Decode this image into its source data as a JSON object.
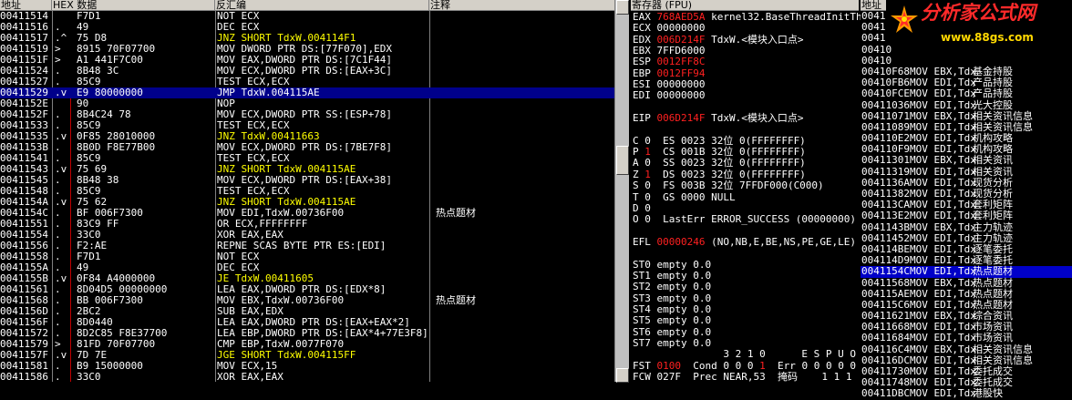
{
  "disasm": {
    "headers": [
      "地址",
      "HEX 数据",
      "反汇编",
      "注释"
    ],
    "rows": [
      {
        "addr": "00411514",
        "mark": "",
        "hex": "F7D1",
        "asm": "NOT ECX",
        "comment": "",
        "jump": false,
        "sel": false
      },
      {
        "addr": "00411516",
        "mark": ".",
        "hex": "49",
        "asm": "DEC ECX",
        "comment": "",
        "jump": false,
        "sel": false
      },
      {
        "addr": "00411517",
        "mark": ".^",
        "hex": "75 D8",
        "asm": "JNZ SHORT TdxW.004114F1",
        "comment": "",
        "jump": true,
        "sel": false
      },
      {
        "addr": "00411519",
        "mark": ">",
        "hex": "8915 70F07700",
        "asm": "MOV DWORD PTR DS:[77F070],EDX",
        "comment": "",
        "jump": false,
        "sel": false
      },
      {
        "addr": "0041151F",
        "mark": ">",
        "hex": "A1 441F7C00",
        "asm": "MOV EAX,DWORD PTR DS:[7C1F44]",
        "comment": "",
        "jump": false,
        "sel": false
      },
      {
        "addr": "00411524",
        "mark": ".",
        "hex": "8B48 3C",
        "asm": "MOV ECX,DWORD PTR DS:[EAX+3C]",
        "comment": "",
        "jump": false,
        "sel": false
      },
      {
        "addr": "00411527",
        "mark": ".",
        "hex": "85C9",
        "asm": "TEST ECX,ECX",
        "comment": "",
        "jump": false,
        "sel": false
      },
      {
        "addr": "00411529",
        "mark": ".v",
        "hex": "E9 80000000",
        "asm": "JMP TdxW.004115AE",
        "comment": "",
        "jump": true,
        "sel": true
      },
      {
        "addr": "0041152E",
        "mark": "",
        "hex": "90",
        "asm": "NOP",
        "comment": "",
        "jump": false,
        "sel": false
      },
      {
        "addr": "0041152F",
        "mark": ".",
        "hex": "8B4C24 78",
        "asm": "MOV ECX,DWORD PTR SS:[ESP+78]",
        "comment": "",
        "jump": false,
        "sel": false
      },
      {
        "addr": "00411533",
        "mark": ".",
        "hex": "85C9",
        "asm": "TEST ECX,ECX",
        "comment": "",
        "jump": false,
        "sel": false
      },
      {
        "addr": "00411535",
        "mark": ".v",
        "hex": "0F85 28010000",
        "asm": "JNZ TdxW.00411663",
        "comment": "",
        "jump": true,
        "sel": false
      },
      {
        "addr": "0041153B",
        "mark": ".",
        "hex": "8B0D F8E77B00",
        "asm": "MOV ECX,DWORD PTR DS:[7BE7F8]",
        "comment": "",
        "jump": false,
        "sel": false
      },
      {
        "addr": "00411541",
        "mark": ".",
        "hex": "85C9",
        "asm": "TEST ECX,ECX",
        "comment": "",
        "jump": false,
        "sel": false
      },
      {
        "addr": "00411543",
        "mark": ".v",
        "hex": "75 69",
        "asm": "JNZ SHORT TdxW.004115AE",
        "comment": "",
        "jump": true,
        "sel": false
      },
      {
        "addr": "00411545",
        "mark": ".",
        "hex": "8B48 38",
        "asm": "MOV ECX,DWORD PTR DS:[EAX+38]",
        "comment": "",
        "jump": false,
        "sel": false
      },
      {
        "addr": "00411548",
        "mark": ".",
        "hex": "85C9",
        "asm": "TEST ECX,ECX",
        "comment": "",
        "jump": false,
        "sel": false
      },
      {
        "addr": "0041154A",
        "mark": ".v",
        "hex": "75 62",
        "asm": "JNZ SHORT TdxW.004115AE",
        "comment": "",
        "jump": true,
        "sel": false
      },
      {
        "addr": "0041154C",
        "mark": ".",
        "hex": "BF 006F7300",
        "asm": "MOV EDI,TdxW.00736F00",
        "comment": "热点题材",
        "jump": false,
        "sel": false
      },
      {
        "addr": "00411551",
        "mark": ".",
        "hex": "83C9 FF",
        "asm": "OR ECX,FFFFFFFF",
        "comment": "",
        "jump": false,
        "sel": false
      },
      {
        "addr": "00411554",
        "mark": ".",
        "hex": "33C0",
        "asm": "XOR EAX,EAX",
        "comment": "",
        "jump": false,
        "sel": false
      },
      {
        "addr": "00411556",
        "mark": ".",
        "hex": "F2:AE",
        "asm": "REPNE SCAS BYTE PTR ES:[EDI]",
        "comment": "",
        "jump": false,
        "sel": false
      },
      {
        "addr": "00411558",
        "mark": ".",
        "hex": "F7D1",
        "asm": "NOT ECX",
        "comment": "",
        "jump": false,
        "sel": false
      },
      {
        "addr": "0041155A",
        "mark": ".",
        "hex": "49",
        "asm": "DEC ECX",
        "comment": "",
        "jump": false,
        "sel": false
      },
      {
        "addr": "0041155B",
        "mark": ".v",
        "hex": "0F84 A4000000",
        "asm": "JE TdxW.00411605",
        "comment": "",
        "jump": true,
        "sel": false
      },
      {
        "addr": "00411561",
        "mark": ".",
        "hex": "8D04D5 00000000",
        "asm": "LEA EAX,DWORD PTR DS:[EDX*8]",
        "comment": "",
        "jump": false,
        "sel": false
      },
      {
        "addr": "00411568",
        "mark": ".",
        "hex": "BB 006F7300",
        "asm": "MOV EBX,TdxW.00736F00",
        "comment": "热点题材",
        "jump": false,
        "sel": false
      },
      {
        "addr": "0041156D",
        "mark": ".",
        "hex": "2BC2",
        "asm": "SUB EAX,EDX",
        "comment": "",
        "jump": false,
        "sel": false
      },
      {
        "addr": "0041156F",
        "mark": ".",
        "hex": "8D0440",
        "asm": "LEA EAX,DWORD PTR DS:[EAX+EAX*2]",
        "comment": "",
        "jump": false,
        "sel": false
      },
      {
        "addr": "00411572",
        "mark": ".",
        "hex": "8D2C85 F8E37700",
        "asm": "LEA EBP,DWORD PTR DS:[EAX*4+77E3F8]",
        "comment": "",
        "jump": false,
        "sel": false
      },
      {
        "addr": "00411579",
        "mark": ">",
        "hex": "81FD 70F07700",
        "asm": "CMP EBP,TdxW.0077F070",
        "comment": "",
        "jump": false,
        "sel": false
      },
      {
        "addr": "0041157F",
        "mark": ".v",
        "hex": "7D 7E",
        "asm": "JGE SHORT TdxW.004115FF",
        "comment": "",
        "jump": true,
        "sel": false
      },
      {
        "addr": "00411581",
        "mark": ".",
        "hex": "B9 15000000",
        "asm": "MOV ECX,15",
        "comment": "",
        "jump": false,
        "sel": false
      },
      {
        "addr": "00411586",
        "mark": ".",
        "hex": "33C0",
        "asm": "XOR EAX,EAX",
        "comment": "",
        "jump": false,
        "sel": false
      }
    ]
  },
  "registers": {
    "header": "寄存器 (FPU)",
    "lines": [
      [
        {
          "t": "EAX "
        },
        {
          "t": "768AED5A",
          "red": true
        },
        {
          "t": " kernel32.BaseThreadInitTh"
        }
      ],
      [
        {
          "t": "ECX 00000000"
        }
      ],
      [
        {
          "t": "EDX "
        },
        {
          "t": "006D214F",
          "red": true
        },
        {
          "t": " TdxW.<模块入口点>"
        }
      ],
      [
        {
          "t": "EBX 7FFD6000"
        }
      ],
      [
        {
          "t": "ESP "
        },
        {
          "t": "0012FF8C",
          "red": true
        }
      ],
      [
        {
          "t": "EBP "
        },
        {
          "t": "0012FF94",
          "red": true
        }
      ],
      [
        {
          "t": "ESI 00000000"
        }
      ],
      [
        {
          "t": "EDI 00000000"
        }
      ],
      [
        {
          "t": ""
        }
      ],
      [
        {
          "t": "EIP "
        },
        {
          "t": "006D214F",
          "red": true
        },
        {
          "t": " TdxW.<模块入口点>"
        }
      ],
      [
        {
          "t": ""
        }
      ],
      [
        {
          "t": "C 0  ES 0023 32位 0(FFFFFFFF)"
        }
      ],
      [
        {
          "t": "P "
        },
        {
          "t": "1",
          "red": true
        },
        {
          "t": "  CS 001B 32位 0(FFFFFFFF)"
        }
      ],
      [
        {
          "t": "A 0  SS 0023 32位 0(FFFFFFFF)"
        }
      ],
      [
        {
          "t": "Z "
        },
        {
          "t": "1",
          "red": true
        },
        {
          "t": "  DS 0023 32位 0(FFFFFFFF)"
        }
      ],
      [
        {
          "t": "S 0  FS 003B 32位 7FFDF000(C000)"
        }
      ],
      [
        {
          "t": "T 0  GS 0000 NULL"
        }
      ],
      [
        {
          "t": "D 0"
        }
      ],
      [
        {
          "t": "O 0  LastErr ERROR_SUCCESS (00000000)"
        }
      ],
      [
        {
          "t": ""
        }
      ],
      [
        {
          "t": "EFL "
        },
        {
          "t": "00000246",
          "red": true
        },
        {
          "t": " (NO,NB,E,BE,NS,PE,GE,LE)"
        }
      ],
      [
        {
          "t": ""
        }
      ],
      [
        {
          "t": "ST0 empty 0.0"
        }
      ],
      [
        {
          "t": "ST1 empty 0.0"
        }
      ],
      [
        {
          "t": "ST2 empty 0.0"
        }
      ],
      [
        {
          "t": "ST3 empty 0.0"
        }
      ],
      [
        {
          "t": "ST4 empty 0.0"
        }
      ],
      [
        {
          "t": "ST5 empty 0.0"
        }
      ],
      [
        {
          "t": "ST6 empty 0.0"
        }
      ],
      [
        {
          "t": "ST7 empty 0.0"
        }
      ],
      [
        {
          "t": "               3 2 1 0      E S P U O"
        }
      ],
      [
        {
          "t": "FST "
        },
        {
          "t": "0100",
          "red": true
        },
        {
          "t": "  Cond 0 0 0 "
        },
        {
          "t": "1",
          "red": true
        },
        {
          "t": "  Err 0 0 0 0 0"
        }
      ],
      [
        {
          "t": "FCW 027F  Prec NEAR,53  掩码    1 1 1"
        }
      ]
    ]
  },
  "right_pane": {
    "header": "地址",
    "rows": [
      {
        "addr": "00410",
        "asm": "",
        "comment": "",
        "sel": false
      },
      {
        "addr": "00410",
        "asm": "",
        "comment": "",
        "sel": false
      },
      {
        "addr": "00410",
        "asm": "",
        "comment": "",
        "sel": false
      },
      {
        "addr": "00410",
        "asm": "",
        "comment": "",
        "sel": false
      },
      {
        "addr": "00410",
        "asm": "",
        "comment": "",
        "sel": false
      },
      {
        "addr": "00410F68",
        "asm": "MOV EBX,Tdx",
        "comment": "基金持股",
        "sel": false
      },
      {
        "addr": "00410FB6",
        "asm": "MOV EDI,Tdx",
        "comment": "产品持股",
        "sel": false
      },
      {
        "addr": "00410FCE",
        "asm": "MOV EDI,Tdx",
        "comment": "产品持股",
        "sel": false
      },
      {
        "addr": "00411036",
        "asm": "MOV EDI,Tdx",
        "comment": "光大控股",
        "sel": false
      },
      {
        "addr": "00411071",
        "asm": "MOV EBX,Tdx",
        "comment": "相关资讯信息",
        "sel": false
      },
      {
        "addr": "00411089",
        "asm": "MOV EDI,Tdx",
        "comment": "相关资讯信息",
        "sel": false
      },
      {
        "addr": "004110E2",
        "asm": "MOV EDI,Tdx",
        "comment": "机构攻略",
        "sel": false
      },
      {
        "addr": "004110F9",
        "asm": "MOV EDI,Tdx",
        "comment": "机构攻略",
        "sel": false
      },
      {
        "addr": "00411301",
        "asm": "MOV EBX,Tdx",
        "comment": "相关资讯",
        "sel": false
      },
      {
        "addr": "00411319",
        "asm": "MOV EDI,Tdx",
        "comment": "相关资讯",
        "sel": false
      },
      {
        "addr": "0041136A",
        "asm": "MOV EDI,Tdx",
        "comment": "现货分析",
        "sel": false
      },
      {
        "addr": "00411382",
        "asm": "MOV EDI,Tdx",
        "comment": "现货分析",
        "sel": false
      },
      {
        "addr": "004113CA",
        "asm": "MOV EDI,Tdx",
        "comment": "套利矩阵",
        "sel": false
      },
      {
        "addr": "004113E2",
        "asm": "MOV EDI,Tdx",
        "comment": "套利矩阵",
        "sel": false
      },
      {
        "addr": "0041143B",
        "asm": "MOV EBX,Tdx",
        "comment": "主力轨迹",
        "sel": false
      },
      {
        "addr": "00411452",
        "asm": "MOV EDI,Tdx",
        "comment": "主力轨迹",
        "sel": false
      },
      {
        "addr": "004114BE",
        "asm": "MOV EDI,Tdx",
        "comment": "逐笔委托",
        "sel": false
      },
      {
        "addr": "004114D9",
        "asm": "MOV EDI,Tdx",
        "comment": "逐笔委托",
        "sel": false
      },
      {
        "addr": "0041154C",
        "asm": "MOV EDI,Tdx",
        "comment": "热点题材",
        "sel": true
      },
      {
        "addr": "00411568",
        "asm": "MOV EBX,Tdx",
        "comment": "热点题材",
        "sel": false
      },
      {
        "addr": "004115AE",
        "asm": "MOV EDI,Tdx",
        "comment": "热点题材",
        "sel": false
      },
      {
        "addr": "004115C6",
        "asm": "MOV EDI,Tdx",
        "comment": "热点题材",
        "sel": false
      },
      {
        "addr": "00411621",
        "asm": "MOV EBX,Tdx",
        "comment": "综合资讯",
        "sel": false
      },
      {
        "addr": "00411668",
        "asm": "MOV EDI,Tdx",
        "comment": "市场资讯",
        "sel": false
      },
      {
        "addr": "00411684",
        "asm": "MOV EDI,Tdx",
        "comment": "市场资讯",
        "sel": false
      },
      {
        "addr": "004116C4",
        "asm": "MOV EBX,Tdx",
        "comment": "相关资讯信息",
        "sel": false
      },
      {
        "addr": "004116DC",
        "asm": "MOV EDI,Tdx",
        "comment": "相关资讯信息",
        "sel": false
      },
      {
        "addr": "00411730",
        "asm": "MOV EDI,Tdx",
        "comment": "委托成交",
        "sel": false
      },
      {
        "addr": "00411748",
        "asm": "MOV EDI,Tdx",
        "comment": "委托成交",
        "sel": false
      },
      {
        "addr": "00411DBC",
        "asm": "MOV EDI,Tdx",
        "comment": "港股快",
        "sel": false
      }
    ]
  },
  "watermark": {
    "title": "分析家公式网",
    "url": "www.88gs.com"
  },
  "colors": {
    "jump": "#ffff00",
    "selection": "#00008b",
    "register_changed": "#ff2020"
  }
}
